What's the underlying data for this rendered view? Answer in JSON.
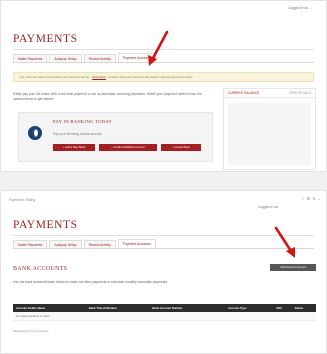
{
  "top": {
    "user_line": "Logged in as ...",
    "title": "PAYMENTS",
    "tabs": [
      "Make Payments",
      "Autopay Setup",
      "Recent Activity",
      "Payment Accounts"
    ],
    "notice": {
      "before": "You currently have not finished your account set-up.",
      "link": "Click here",
      "after": "to add a Payment Account and begin making payments online."
    },
    "intro_text": "Easily pay your bill online with a one-time payment or set up automatic recurring payments. Select your payment method from the options below to get started.",
    "setup": {
      "title": "PAY IN BANKING TODAY",
      "subtitle": "Pay your bill using a bank account",
      "buttons": [
        "+ Add a New Bank",
        "+ Credit Card/Debit Account",
        "+ Cancel Bank"
      ]
    },
    "sidebar": {
      "label": "CURRENT BALANCE",
      "action": "VIEW DETAILS"
    }
  },
  "bottom": {
    "breadcrumb": "Payments / Billing",
    "tool_icons": [
      "/",
      "⚙",
      "ℹ",
      "–"
    ],
    "user_line": "Logged in as",
    "title": "PAYMENTS",
    "tabs": [
      "Make Payments",
      "Autopay Setup",
      "Recent Activity",
      "Payment Accounts"
    ],
    "manage_button": "Add Payment Account",
    "section_title": "BANK ACCOUNTS",
    "description": "Use the bank accounts listed below to make one-time payments or schedule monthly automatic payments.",
    "table": {
      "headers": [
        "Account Holder Name",
        "Bank Transit Number",
        "Bank Account Number",
        "Account Type",
        "Edit",
        "Delete"
      ],
      "empty_text": "No data available in table"
    },
    "showing": "Showing 0 to 0 of 0 entries"
  },
  "colors": {
    "accent": "#9e1d1d",
    "button": "#a31f24",
    "header": "#2c2c2c",
    "notice": "#f8f4dc"
  }
}
